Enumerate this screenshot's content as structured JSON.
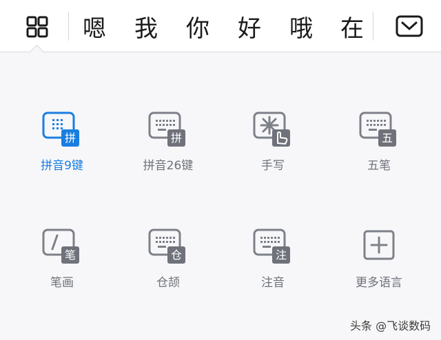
{
  "candidates": [
    "嗯",
    "我",
    "你",
    "好",
    "哦",
    "在"
  ],
  "modes": [
    {
      "label": "拼音9键",
      "badge": "拼",
      "icon": "keyboard-9key-icon",
      "active": true
    },
    {
      "label": "拼音26键",
      "badge": "拼",
      "icon": "keyboard-26key-icon",
      "active": false
    },
    {
      "label": "手写",
      "badge": "",
      "icon": "handwriting-icon",
      "active": false
    },
    {
      "label": "五笔",
      "badge": "五",
      "icon": "keyboard-wubi-icon",
      "active": false
    },
    {
      "label": "笔画",
      "badge": "笔",
      "icon": "stroke-icon",
      "active": false
    },
    {
      "label": "仓颉",
      "badge": "仓",
      "icon": "keyboard-cangjie-icon",
      "active": false
    },
    {
      "label": "注音",
      "badge": "注",
      "icon": "keyboard-zhuyin-icon",
      "active": false
    },
    {
      "label": "更多语言",
      "badge": "",
      "icon": "plus-box-icon",
      "active": false
    }
  ],
  "watermark": "头条 @飞谈数码",
  "colors": {
    "accent": "#1a7ee0",
    "icon_gray": "#7d8088",
    "badge_gray": "#6f727a"
  }
}
